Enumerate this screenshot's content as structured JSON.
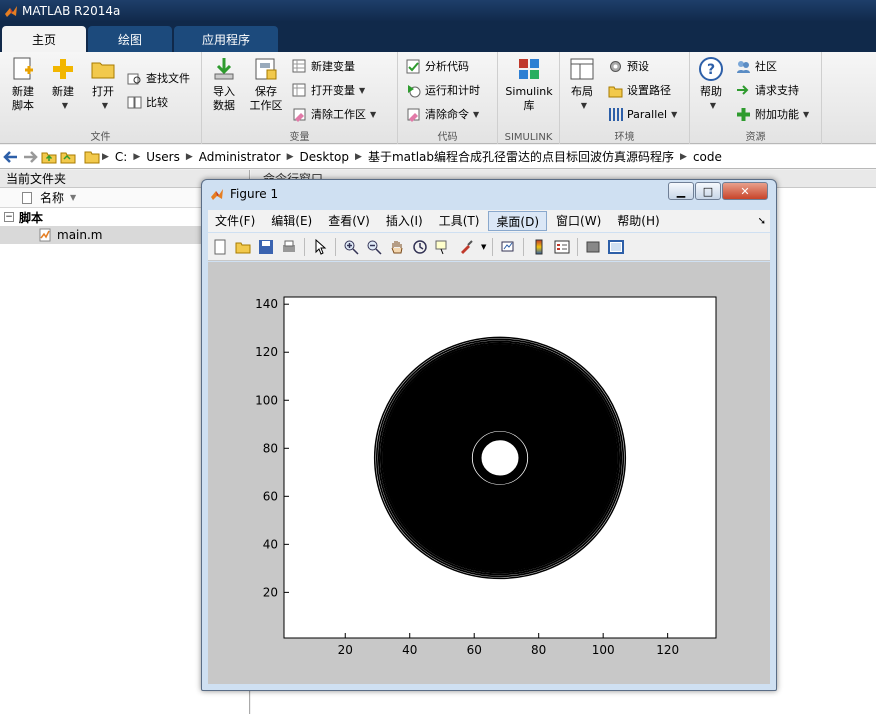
{
  "app": {
    "title": "MATLAB R2014a"
  },
  "tabs": [
    "主页",
    "绘图",
    "应用程序"
  ],
  "ribbon": {
    "file": {
      "label": "文件",
      "new_script": [
        "新建",
        "脚本"
      ],
      "new": "新建",
      "open": "打开",
      "find_files": "查找文件",
      "compare": "比较"
    },
    "variable": {
      "label": "变量",
      "import": [
        "导入",
        "数据"
      ],
      "save_ws": [
        "保存",
        "工作区"
      ],
      "new_var": "新建变量",
      "open_var": "打开变量",
      "clear_ws": "清除工作区"
    },
    "code": {
      "label": "代码",
      "analyze": "分析代码",
      "run_time": "运行和计时",
      "clear_cmd": "清除命令"
    },
    "simulink": {
      "label": "SIMULINK",
      "lib": [
        "Simulink",
        "库"
      ]
    },
    "env": {
      "label": "环境",
      "layout": "布局",
      "prefs": "预设",
      "set_path": "设置路径",
      "parallel": "Parallel"
    },
    "resources": {
      "label": "资源",
      "help": "帮助",
      "community": "社区",
      "support": "请求支持",
      "addons": "附加功能"
    }
  },
  "address": [
    "C:",
    "Users",
    "Administrator",
    "Desktop",
    "基于matlab编程合成孔径雷达的点目标回波仿真源码程序",
    "code"
  ],
  "left_panel": {
    "title": "当前文件夹",
    "col_name": "名称",
    "folder": "脚本",
    "file": "main.m"
  },
  "right_panel": {
    "title": "命令行窗口"
  },
  "figure": {
    "title": "Figure 1",
    "menus": [
      "文件(F)",
      "编辑(E)",
      "查看(V)",
      "插入(I)",
      "工具(T)",
      "桌面(D)",
      "窗口(W)",
      "帮助(H)"
    ]
  },
  "chart_data": {
    "type": "heatmap",
    "description_style": "concentric-ring-contour",
    "xlim": [
      1,
      135
    ],
    "ylim": [
      1,
      143
    ],
    "xticks": [
      20,
      40,
      60,
      80,
      100,
      120
    ],
    "yticks": [
      20,
      40,
      60,
      80,
      100,
      120,
      140
    ],
    "center": [
      68,
      76
    ],
    "ring_count": 30,
    "colors": {
      "fg": "#000000",
      "bg": "#ffffff"
    }
  }
}
